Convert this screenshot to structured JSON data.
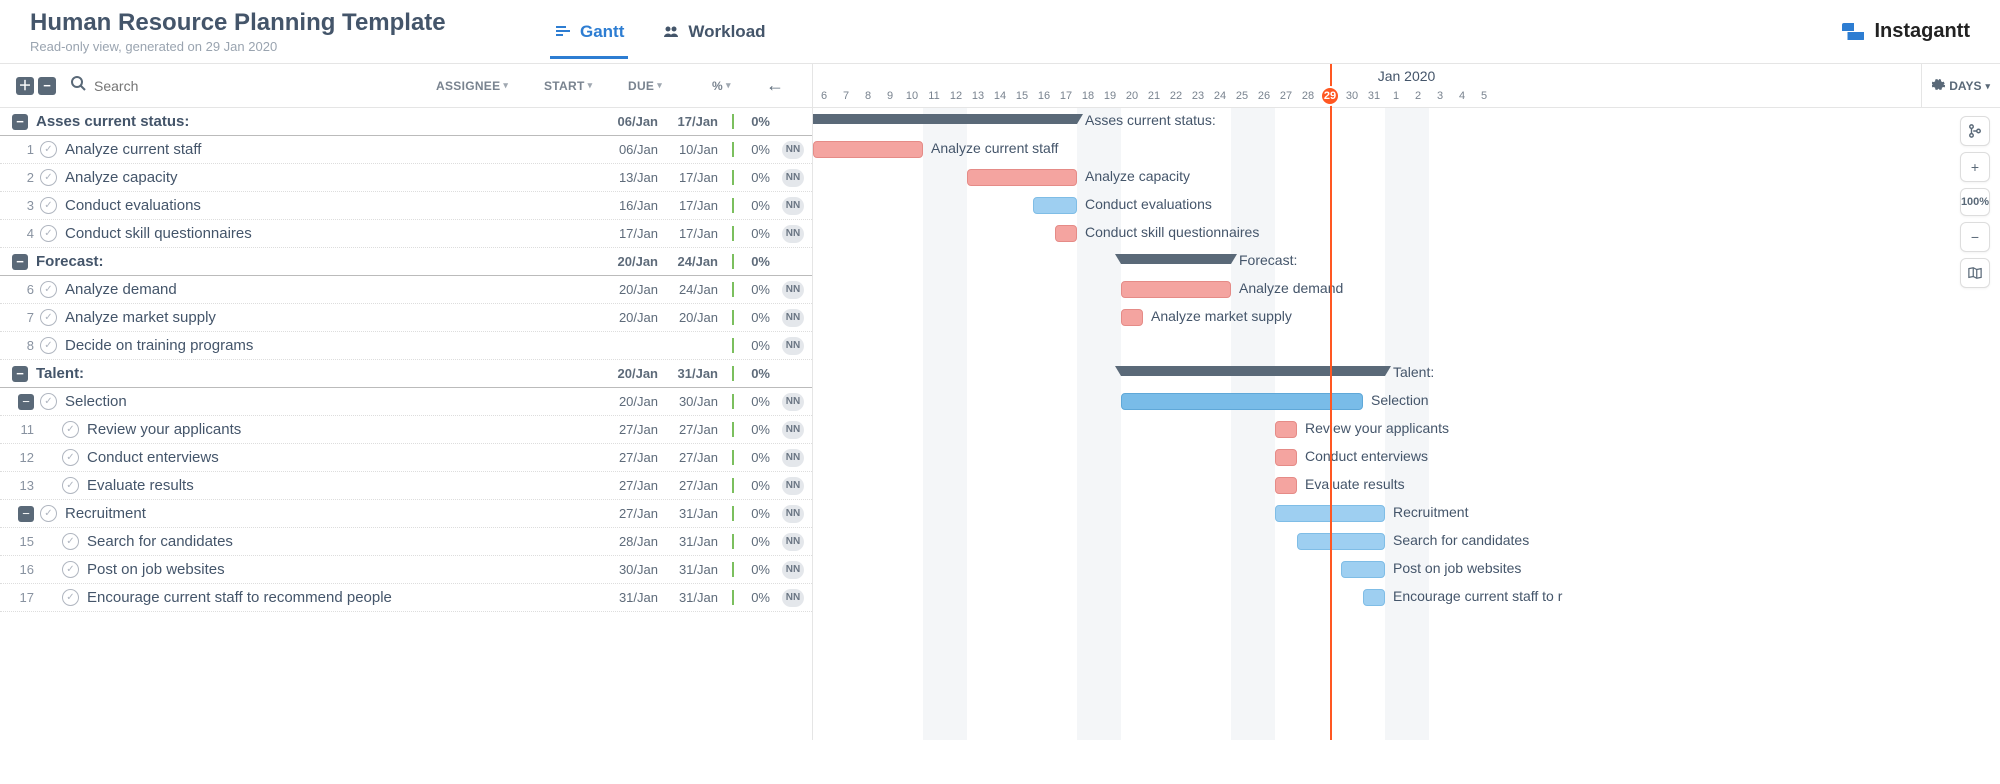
{
  "header": {
    "title": "Human Resource Planning Template",
    "subtitle": "Read-only view, generated on 29 Jan 2020",
    "brand": "Instagantt"
  },
  "tabs": {
    "gantt": "Gantt",
    "workload": "Workload"
  },
  "toolbar": {
    "search_placeholder": "Search",
    "col_assignee": "ASSIGNEE",
    "col_start": "START",
    "col_due": "DUE",
    "col_pct": "%"
  },
  "timeline": {
    "month": "Jan 2020",
    "days_label": "DAYS",
    "zoom_text": "100%",
    "today_day": 29,
    "days": [
      6,
      7,
      8,
      9,
      10,
      11,
      12,
      13,
      14,
      15,
      16,
      17,
      18,
      19,
      20,
      21,
      22,
      23,
      24,
      25,
      26,
      27,
      28,
      29,
      30,
      31,
      1,
      2,
      3,
      4,
      5
    ]
  },
  "tasks": [
    {
      "idx": "",
      "type": "group",
      "name": "Asses current status:",
      "start": "06/Jan",
      "due": "17/Jan",
      "pct": "0%",
      "nn": false,
      "indent": 0,
      "bar": {
        "kind": "group",
        "from": 6,
        "to": 17,
        "color": "gray"
      }
    },
    {
      "idx": "1",
      "type": "task",
      "name": "Analyze current staff",
      "start": "06/Jan",
      "due": "10/Jan",
      "pct": "0%",
      "nn": true,
      "indent": 1,
      "bar": {
        "kind": "bar",
        "from": 6,
        "to": 10,
        "color": "red"
      }
    },
    {
      "idx": "2",
      "type": "task",
      "name": "Analyze capacity",
      "start": "13/Jan",
      "due": "17/Jan",
      "pct": "0%",
      "nn": true,
      "indent": 1,
      "bar": {
        "kind": "bar",
        "from": 13,
        "to": 17,
        "color": "red"
      }
    },
    {
      "idx": "3",
      "type": "task",
      "name": "Conduct evaluations",
      "start": "16/Jan",
      "due": "17/Jan",
      "pct": "0%",
      "nn": true,
      "indent": 1,
      "bar": {
        "kind": "bar",
        "from": 16,
        "to": 17,
        "color": "blue"
      }
    },
    {
      "idx": "4",
      "type": "task",
      "name": "Conduct skill questionnaires",
      "start": "17/Jan",
      "due": "17/Jan",
      "pct": "0%",
      "nn": true,
      "indent": 1,
      "bar": {
        "kind": "bar",
        "from": 17,
        "to": 17,
        "color": "red"
      }
    },
    {
      "idx": "",
      "type": "group",
      "name": "Forecast:",
      "start": "20/Jan",
      "due": "24/Jan",
      "pct": "0%",
      "nn": false,
      "indent": 0,
      "bar": {
        "kind": "group",
        "from": 20,
        "to": 24,
        "color": "gray"
      }
    },
    {
      "idx": "6",
      "type": "task",
      "name": "Analyze demand",
      "start": "20/Jan",
      "due": "24/Jan",
      "pct": "0%",
      "nn": true,
      "indent": 1,
      "bar": {
        "kind": "bar",
        "from": 20,
        "to": 24,
        "color": "red"
      }
    },
    {
      "idx": "7",
      "type": "task",
      "name": "Analyze market supply",
      "start": "20/Jan",
      "due": "20/Jan",
      "pct": "0%",
      "nn": true,
      "indent": 1,
      "bar": {
        "kind": "bar",
        "from": 20,
        "to": 20,
        "color": "red"
      }
    },
    {
      "idx": "8",
      "type": "task",
      "name": "Decide on training programs",
      "start": "",
      "due": "",
      "pct": "0%",
      "nn": true,
      "indent": 1,
      "bar": null
    },
    {
      "idx": "",
      "type": "group",
      "name": "Talent:",
      "start": "20/Jan",
      "due": "31/Jan",
      "pct": "0%",
      "nn": false,
      "indent": 0,
      "bar": {
        "kind": "group",
        "from": 20,
        "to": 31,
        "color": "gray"
      }
    },
    {
      "idx": "",
      "type": "subgroup",
      "name": "Selection",
      "start": "20/Jan",
      "due": "30/Jan",
      "pct": "0%",
      "nn": true,
      "indent": 1,
      "bar": {
        "kind": "bar",
        "from": 20,
        "to": 30,
        "color": "darkblue"
      }
    },
    {
      "idx": "11",
      "type": "task",
      "name": "Review your applicants",
      "start": "27/Jan",
      "due": "27/Jan",
      "pct": "0%",
      "nn": true,
      "indent": 2,
      "bar": {
        "kind": "bar",
        "from": 27,
        "to": 27,
        "color": "red"
      }
    },
    {
      "idx": "12",
      "type": "task",
      "name": "Conduct enterviews",
      "start": "27/Jan",
      "due": "27/Jan",
      "pct": "0%",
      "nn": true,
      "indent": 2,
      "bar": {
        "kind": "bar",
        "from": 27,
        "to": 27,
        "color": "red"
      }
    },
    {
      "idx": "13",
      "type": "task",
      "name": "Evaluate results",
      "start": "27/Jan",
      "due": "27/Jan",
      "pct": "0%",
      "nn": true,
      "indent": 2,
      "bar": {
        "kind": "bar",
        "from": 27,
        "to": 27,
        "color": "red"
      }
    },
    {
      "idx": "",
      "type": "subgroup",
      "name": "Recruitment",
      "start": "27/Jan",
      "due": "31/Jan",
      "pct": "0%",
      "nn": true,
      "indent": 1,
      "bar": {
        "kind": "bar",
        "from": 27,
        "to": 31,
        "color": "blue"
      }
    },
    {
      "idx": "15",
      "type": "task",
      "name": "Search for candidates",
      "start": "28/Jan",
      "due": "31/Jan",
      "pct": "0%",
      "nn": true,
      "indent": 2,
      "bar": {
        "kind": "bar",
        "from": 28,
        "to": 31,
        "color": "blue"
      }
    },
    {
      "idx": "16",
      "type": "task",
      "name": "Post on job websites",
      "start": "30/Jan",
      "due": "31/Jan",
      "pct": "0%",
      "nn": true,
      "indent": 2,
      "bar": {
        "kind": "bar",
        "from": 30,
        "to": 31,
        "color": "blue"
      }
    },
    {
      "idx": "17",
      "type": "task",
      "name": "Encourage current staff to recommend people",
      "start": "31/Jan",
      "due": "31/Jan",
      "pct": "0%",
      "nn": true,
      "indent": 2,
      "bar": {
        "kind": "bar",
        "from": 31,
        "to": 31,
        "color": "blue"
      },
      "label_override": "Encourage current staff to r"
    }
  ]
}
